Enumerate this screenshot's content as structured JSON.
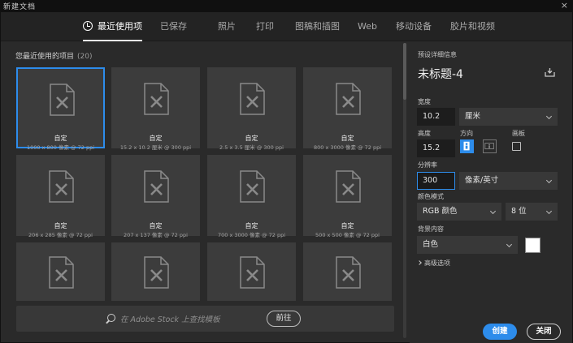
{
  "window": {
    "title": "新建文档",
    "close_glyph": "×"
  },
  "tabs": [
    {
      "label": "最近使用项",
      "active": true
    },
    {
      "label": "已保存"
    },
    {
      "label": "照片"
    },
    {
      "label": "打印"
    },
    {
      "label": "图稿和插图"
    },
    {
      "label": "Web"
    },
    {
      "label": "移动设备"
    },
    {
      "label": "胶片和视频"
    }
  ],
  "recent": {
    "header": "您最近使用的项目",
    "count": "(20)",
    "items": [
      {
        "name": "自定",
        "size": "1000 x 800 像素 @ 72 ppi"
      },
      {
        "name": "自定",
        "size": "15.2 x 10.2 厘米 @ 300 ppi"
      },
      {
        "name": "自定",
        "size": "2.5 x 3.5 厘米 @ 300 ppi"
      },
      {
        "name": "自定",
        "size": "800 x 3000 像素 @ 72 ppi"
      },
      {
        "name": "自定",
        "size": "206 x 285 像素 @ 72 ppi"
      },
      {
        "name": "自定",
        "size": "207 x 137 像素 @ 72 ppi"
      },
      {
        "name": "自定",
        "size": "700 x 3000 像素 @ 72 ppi"
      },
      {
        "name": "自定",
        "size": "500 x 500 像素 @ 72 ppi"
      }
    ]
  },
  "stock": {
    "placeholder": "在 Adobe Stock 上查找模板",
    "go": "前往"
  },
  "preset": {
    "section_label": "预设详细信息",
    "doc_name": "未标题-4",
    "width_label": "宽度",
    "width_value": "10.2",
    "width_unit": "厘米",
    "height_label": "高度",
    "height_value": "15.2",
    "orientation_label": "方向",
    "artboard_label": "画板",
    "resolution_label": "分辨率",
    "resolution_value": "300",
    "resolution_unit": "像素/英寸",
    "color_mode_label": "颜色模式",
    "color_mode": "RGB 颜色",
    "bit_depth": "8 位",
    "background_label": "背景内容",
    "background": "白色",
    "background_swatch": "#ffffff",
    "advanced": "高级选项"
  },
  "buttons": {
    "create": "创建",
    "close": "关闭"
  },
  "colors": {
    "accent": "#2d8ceb",
    "panel": "#2a2a2a",
    "card": "#3c3c3c"
  }
}
